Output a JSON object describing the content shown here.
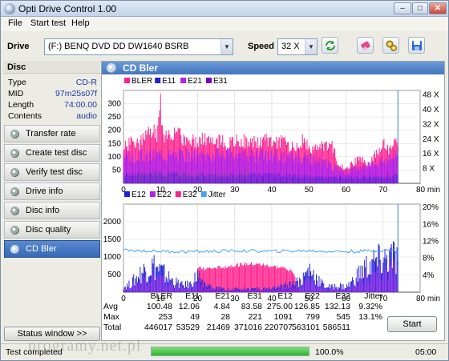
{
  "window": {
    "title": "Opti Drive Control 1.00"
  },
  "titlebar_buttons": {
    "minimize": "–",
    "maximize": "□",
    "close": "✕"
  },
  "menu": [
    "File",
    "Start test",
    "Help"
  ],
  "toolbar": {
    "drive_label": "Drive",
    "drive_value": "(F:)   BENQ DVD DD DW1640 BSRB",
    "speed_label": "Speed",
    "speed_value": "32 X",
    "icons": [
      "refresh-icon",
      "eraser-icon",
      "gears-icon",
      "save-icon"
    ]
  },
  "disc": {
    "heading": "Disc",
    "rows": [
      {
        "label": "Type",
        "value": "CD-R"
      },
      {
        "label": "MID",
        "value": "97m25s07f"
      },
      {
        "label": "Length",
        "value": "74:00.00"
      },
      {
        "label": "Contents",
        "value": "audio"
      }
    ]
  },
  "nav": [
    {
      "label": "Transfer rate",
      "active": false
    },
    {
      "label": "Create test disc",
      "active": false
    },
    {
      "label": "Verify test disc",
      "active": false
    },
    {
      "label": "Drive info",
      "active": false
    },
    {
      "label": "Disc info",
      "active": false
    },
    {
      "label": "Disc quality",
      "active": false
    },
    {
      "label": "CD Bler",
      "active": true
    }
  ],
  "status_window_button": "Status window >>",
  "panel": {
    "title": "CD Bler"
  },
  "chart_data": [
    {
      "type": "area",
      "legend": [
        {
          "name": "BLER",
          "color": "#ff1f8c"
        },
        {
          "name": "E11",
          "color": "#2020d8"
        },
        {
          "name": "E21",
          "color": "#b020e8"
        },
        {
          "name": "E31",
          "color": "#7a00c8"
        }
      ],
      "x_ticks": [
        "0",
        "10",
        "20",
        "30",
        "40",
        "50",
        "60",
        "70",
        "80 min"
      ],
      "y_left_ticks": [
        "50",
        "100",
        "150",
        "200",
        "250",
        "300"
      ],
      "y_right_ticks": [
        "8 X",
        "16 X",
        "24 X",
        "32 X",
        "40 X",
        "48 X"
      ],
      "xlim": [
        0,
        80
      ],
      "ylim": [
        0,
        300
      ],
      "grid": true,
      "series": [
        {
          "name": "BLER",
          "x": [
            0,
            2,
            4,
            6,
            8,
            9,
            10,
            11,
            12,
            14,
            16,
            18,
            20,
            22,
            24,
            26,
            28,
            30,
            32,
            34,
            36,
            38,
            40,
            42,
            44,
            46,
            48,
            50,
            52,
            54,
            56,
            58,
            60,
            62,
            64,
            66,
            68,
            70,
            72,
            73,
            74
          ],
          "values": [
            115,
            140,
            130,
            150,
            180,
            150,
            253,
            160,
            175,
            165,
            150,
            145,
            140,
            150,
            135,
            140,
            130,
            140,
            145,
            135,
            135,
            140,
            145,
            140,
            130,
            120,
            140,
            120,
            110,
            130,
            130,
            65,
            45,
            70,
            80,
            60,
            95,
            130,
            110,
            160,
            145
          ]
        },
        {
          "name": "E11",
          "x": [
            0,
            10,
            20,
            30,
            40,
            50,
            60,
            70,
            74
          ],
          "values": [
            30,
            35,
            30,
            28,
            30,
            25,
            20,
            25,
            30
          ]
        },
        {
          "name": "E21",
          "x": [
            0,
            10,
            20,
            30,
            40,
            50,
            60,
            70,
            74
          ],
          "values": [
            90,
            100,
            95,
            100,
            95,
            90,
            40,
            80,
            95
          ]
        }
      ],
      "speed_line": {
        "name": "speed",
        "x": [
          0,
          74
        ],
        "values": [
          0,
          0
        ]
      }
    },
    {
      "type": "area",
      "legend": [
        {
          "name": "E12",
          "color": "#2020d8"
        },
        {
          "name": "E22",
          "color": "#b020e8"
        },
        {
          "name": "E32",
          "color": "#ff1f8c"
        },
        {
          "name": "Jitter",
          "color": "#4aa0f0"
        }
      ],
      "x_ticks": [
        "0",
        "10",
        "20",
        "30",
        "40",
        "50",
        "60",
        "70",
        "80 min"
      ],
      "y_left_ticks": [
        "500",
        "1000",
        "1500",
        "2000"
      ],
      "y_right_ticks": [
        "4%",
        "8%",
        "12%",
        "16%",
        "20%"
      ],
      "xlim": [
        0,
        80
      ],
      "ylim": [
        0,
        2000
      ],
      "grid": true,
      "series": [
        {
          "name": "E12",
          "x": [
            0,
            2,
            4,
            6,
            8,
            10,
            12,
            14,
            16,
            18,
            20,
            22,
            24,
            26,
            28,
            30,
            32,
            34,
            36,
            38,
            40,
            42,
            44,
            46,
            48,
            50,
            52,
            54,
            56,
            58,
            60,
            62,
            64,
            66,
            68,
            70,
            72,
            74
          ],
          "values": [
            150,
            250,
            500,
            700,
            800,
            650,
            450,
            300,
            200,
            250,
            500,
            200,
            150,
            100,
            100,
            100,
            100,
            100,
            100,
            100,
            100,
            150,
            200,
            300,
            350,
            700,
            450,
            200,
            150,
            200,
            150,
            350,
            600,
            800,
            900,
            950,
            1050,
            1000
          ]
        },
        {
          "name": "E32",
          "x": [
            20,
            24,
            28,
            32,
            36,
            40,
            44,
            46,
            47
          ],
          "values": [
            550,
            550,
            600,
            650,
            650,
            600,
            550,
            450,
            0
          ]
        },
        {
          "name": "Jitter",
          "x": [
            0,
            10,
            20,
            30,
            40,
            50,
            60,
            70,
            74
          ],
          "values": [
            9.5,
            9.3,
            9.2,
            9.4,
            9.3,
            9.4,
            9.2,
            9.5,
            9.3
          ]
        }
      ]
    }
  ],
  "stats": {
    "headers": [
      "BLER",
      "E11",
      "E21",
      "E31",
      "E12",
      "E22",
      "E32",
      "Jitter"
    ],
    "rows": [
      {
        "label": "Avg",
        "values": [
          "100.48",
          "12.06",
          "4.84",
          "83.58",
          "275.00",
          "126.85",
          "132.13",
          "9.32%"
        ]
      },
      {
        "label": "Max",
        "values": [
          "253",
          "49",
          "28",
          "221",
          "1091",
          "799",
          "545",
          "13.1%"
        ]
      },
      {
        "label": "Total",
        "values": [
          "446017",
          "53529",
          "21469",
          "371016",
          "220707",
          "563101",
          "586511",
          ""
        ]
      }
    ]
  },
  "start_button": "Start",
  "status": {
    "text": "Test completed",
    "progress_percent": 100,
    "progress_label": "100.0%",
    "time": "05:00"
  },
  "watermarks": [
    "programy.net.pl",
    "programy.net.pl"
  ],
  "colors": {
    "accent": "#4376c0",
    "bler": "#ff1f8c",
    "e11": "#2020d8",
    "e21": "#b020e8",
    "jitter": "#4aa0f0"
  }
}
